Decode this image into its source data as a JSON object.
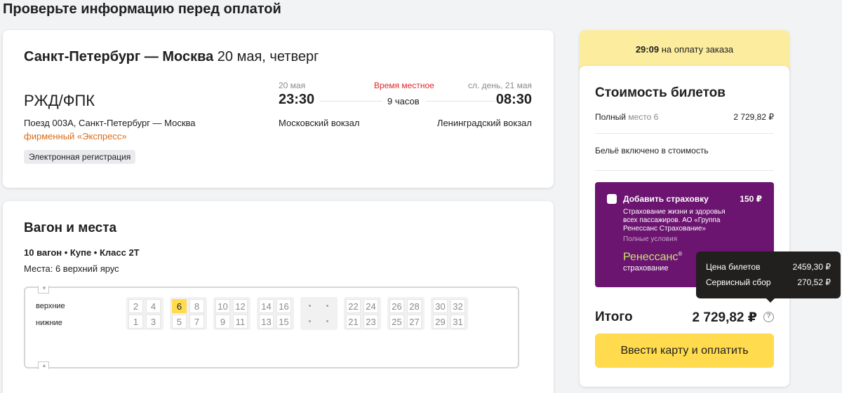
{
  "page_title": "Проверьте информацию перед оплатой",
  "trip": {
    "route": "Санкт-Петербург — Москва",
    "date": "20 мая, четверг",
    "carrier": "РЖД/ФПК",
    "train": "Поезд 003А, Санкт-Петербург — Москва",
    "brand": "фирменный «Экспресс»",
    "registration": "Электронная регистрация",
    "departure": {
      "date": "20 мая",
      "time": "23:30",
      "station": "Московский вокзал"
    },
    "local_time_note": "Время местное",
    "duration": "9 часов",
    "arrival": {
      "date": "сл. день, 21 мая",
      "time": "08:30",
      "station": "Ленинградский вокзал"
    }
  },
  "wagon": {
    "title": "Вагон и места",
    "info": "10 вагон • Купе • Класс 2Т",
    "seats": "Места: 6 верхний ярус",
    "row_upper": "верхние",
    "row_lower": "нижние",
    "compartments": [
      [
        "2",
        "4",
        "1",
        "3"
      ],
      [
        "6",
        "8",
        "5",
        "7"
      ],
      [
        "10",
        "12",
        "9",
        "11"
      ],
      [
        "14",
        "16",
        "13",
        "15"
      ],
      [
        "•",
        "•",
        "•",
        "•"
      ],
      [
        "22",
        "24",
        "21",
        "23"
      ],
      [
        "26",
        "28",
        "25",
        "27"
      ],
      [
        "30",
        "32",
        "29",
        "31"
      ]
    ],
    "selected_seat": "6"
  },
  "timer": {
    "time": "29:09",
    "text": "на оплату заказа"
  },
  "price": {
    "title": "Стоимость билетов",
    "fare_label": "Полный",
    "fare_seat": "место 6",
    "fare_value": "2 729,82 ₽",
    "linen": "Бельё включено в стоимость",
    "insurance": {
      "title": "Добавить страховку",
      "price": "150 ₽",
      "description": "Страхование жизни и здоровья всех пассажиров. АО «Группа Ренессанс Страхование»",
      "link": "Полные условия",
      "logo": "Ренессанс",
      "logo_sub": "страхование"
    },
    "total_label": "Итого",
    "total_value": "2 729,82 ₽",
    "help_glyph": "?",
    "pay_button": "Ввести карту и оплатить"
  },
  "tooltip": {
    "rows": [
      {
        "label": "Цена билетов",
        "value": "2459,30 ₽"
      },
      {
        "label": "Сервисный сбор",
        "value": "270,52 ₽"
      }
    ]
  },
  "colors": {
    "accent_yellow": "#ffdb4d",
    "timer_bg": "#fcec9e",
    "insurance_bg": "#6b1470",
    "brand_orange": "#d96c18",
    "local_time_red": "#e0252a"
  }
}
